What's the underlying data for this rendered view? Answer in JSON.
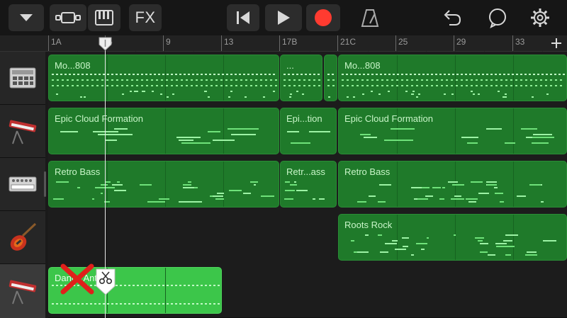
{
  "toolbar": {
    "fx_label": "FX",
    "record_color": "#ff3b30"
  },
  "ruler": {
    "marks": [
      {
        "label": "1A"
      },
      {
        "label": "5"
      },
      {
        "label": "9"
      },
      {
        "label": "13"
      },
      {
        "label": "17B"
      },
      {
        "label": "21C"
      },
      {
        "label": "25"
      },
      {
        "label": "29"
      },
      {
        "label": "33"
      }
    ]
  },
  "tracks": [
    {
      "instrument": "drum-machine-icon",
      "regions": [
        {
          "name": "Mo...808"
        },
        {
          "name": "..."
        },
        {
          "name": ""
        },
        {
          "name": "Mo...808"
        }
      ]
    },
    {
      "instrument": "keyboard-synth-icon",
      "regions": [
        {
          "name": "Epic Cloud Formation"
        },
        {
          "name": "Epi...tion"
        },
        {
          "name": "Epic Cloud Formation"
        }
      ]
    },
    {
      "instrument": "bass-synth-icon",
      "regions": [
        {
          "name": "Retro Bass"
        },
        {
          "name": "Retr...ass"
        },
        {
          "name": "Retro Bass"
        }
      ]
    },
    {
      "instrument": "electric-guitar-icon",
      "regions": [
        {
          "name": "Roots Rock"
        }
      ]
    },
    {
      "instrument": "keyboard-synth-icon",
      "selected": true,
      "regions": [
        {
          "name": "Dance Anthem"
        }
      ]
    }
  ],
  "colors": {
    "region": "#1f7a2a",
    "region_selected": "#3cc64a",
    "note": "#6fe27a",
    "accent_red": "#e0201b"
  }
}
